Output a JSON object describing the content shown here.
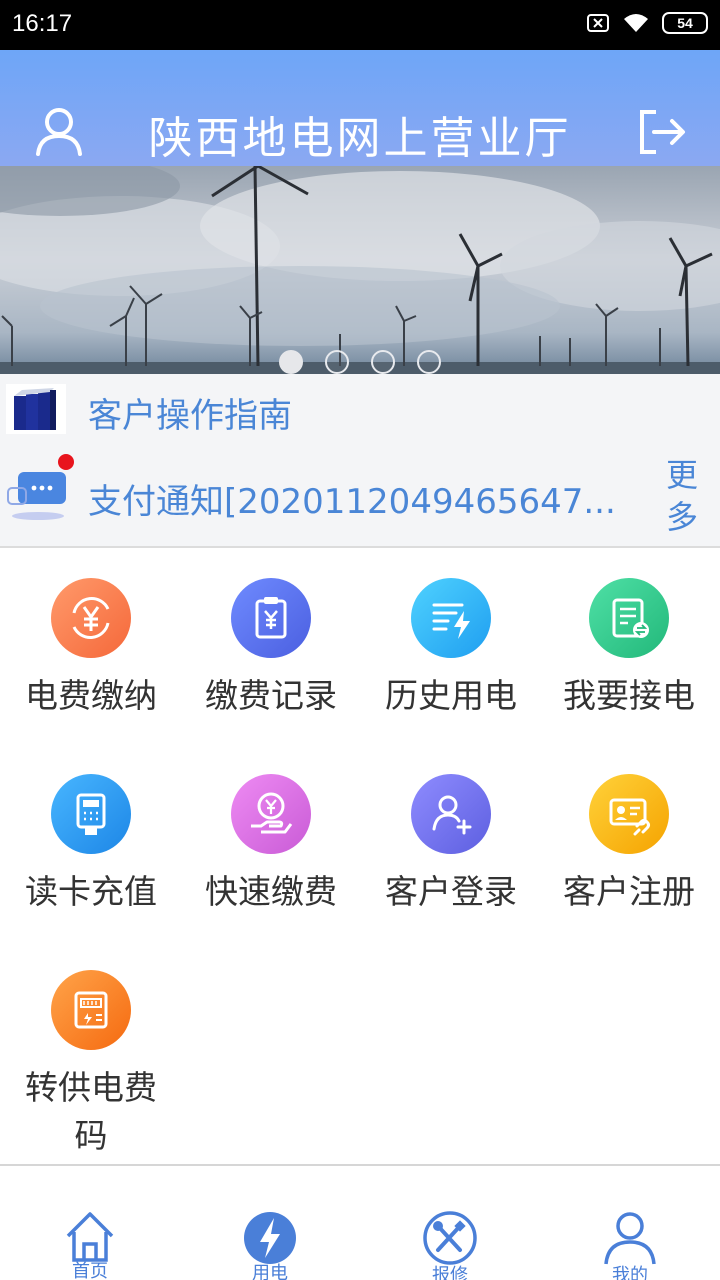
{
  "status_bar": {
    "time": "16:17",
    "battery": "54"
  },
  "header": {
    "title": "陕西地电网上营业厅"
  },
  "banner": {
    "slide_count": 4,
    "active_index": 0
  },
  "guide": {
    "label": "客户操作指南"
  },
  "notice": {
    "text": "支付通知[2020112049465647...",
    "more_label": "更多"
  },
  "grid": [
    {
      "label": "电费缴纳",
      "icon": "yuan-refresh-icon",
      "color": "#f97b4e"
    },
    {
      "label": "缴费记录",
      "icon": "clipboard-yuan-icon",
      "color": "#5b78ef"
    },
    {
      "label": "历史用电",
      "icon": "bolt-list-icon",
      "color": "#2fb2f4"
    },
    {
      "label": "我要接电",
      "icon": "document-exchange-icon",
      "color": "#2ec98d"
    },
    {
      "label": "读卡充值",
      "icon": "card-reader-icon",
      "color": "#2a9af0"
    },
    {
      "label": "快速缴费",
      "icon": "hand-coin-icon",
      "color": "#d86ee0"
    },
    {
      "label": "客户登录",
      "icon": "user-add-icon",
      "color": "#6f70e6"
    },
    {
      "label": "客户注册",
      "icon": "id-card-link-icon",
      "color": "#f7b40d"
    },
    {
      "label": "转供电费码",
      "icon": "meter-icon",
      "color": "#f8821f"
    }
  ],
  "tabs": [
    {
      "label": "首页",
      "icon": "home-icon"
    },
    {
      "label": "用电",
      "icon": "lightning-icon"
    },
    {
      "label": "报修",
      "icon": "tools-icon"
    },
    {
      "label": "我的",
      "icon": "profile-icon"
    }
  ]
}
